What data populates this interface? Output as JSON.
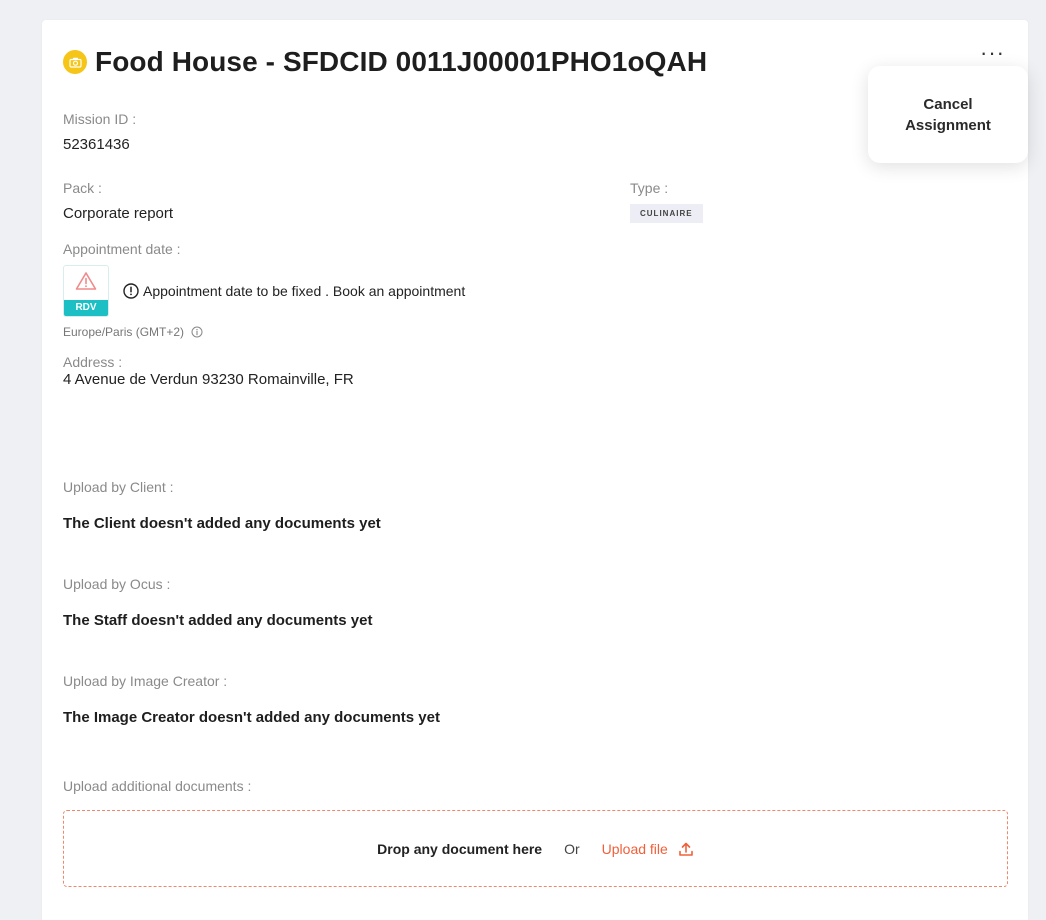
{
  "header": {
    "title": "Food House - SFDCID 0011J00001PHO1oQAH",
    "icon": "camera-icon",
    "more_label": "···"
  },
  "mission": {
    "label": "Mission ID :",
    "value": "52361436"
  },
  "pack": {
    "label": "Pack :",
    "value": "Corporate report"
  },
  "type": {
    "label": "Type :",
    "badge": "CULINAIRE"
  },
  "appointment": {
    "label": "Appointment date :",
    "rdv_tag": "RDV",
    "message": "Appointment date to be fixed . Book an appointment",
    "timezone": "Europe/Paris (GMT+2)"
  },
  "address": {
    "label": "Address :",
    "value": "4 Avenue de Verdun 93230 Romainville, FR"
  },
  "uploads": {
    "client": {
      "label": "Upload by Client :",
      "message": "The Client doesn't added any documents yet"
    },
    "ocus": {
      "label": "Upload by Ocus :",
      "message": "The Staff doesn't added any documents yet"
    },
    "creator": {
      "label": "Upload by Image Creator :",
      "message": "The Image Creator doesn't added any documents yet"
    },
    "additional": {
      "label": "Upload additional documents :",
      "drop_text": "Drop any document here",
      "or_text": "Or",
      "upload_link": "Upload file"
    }
  },
  "popover": {
    "cancel_label": "Cancel Assignment"
  },
  "colors": {
    "accent": "#f0603a",
    "rdv": "#1bbfc4",
    "camera_badge": "#f5c518",
    "warning": "#f08a8a"
  }
}
